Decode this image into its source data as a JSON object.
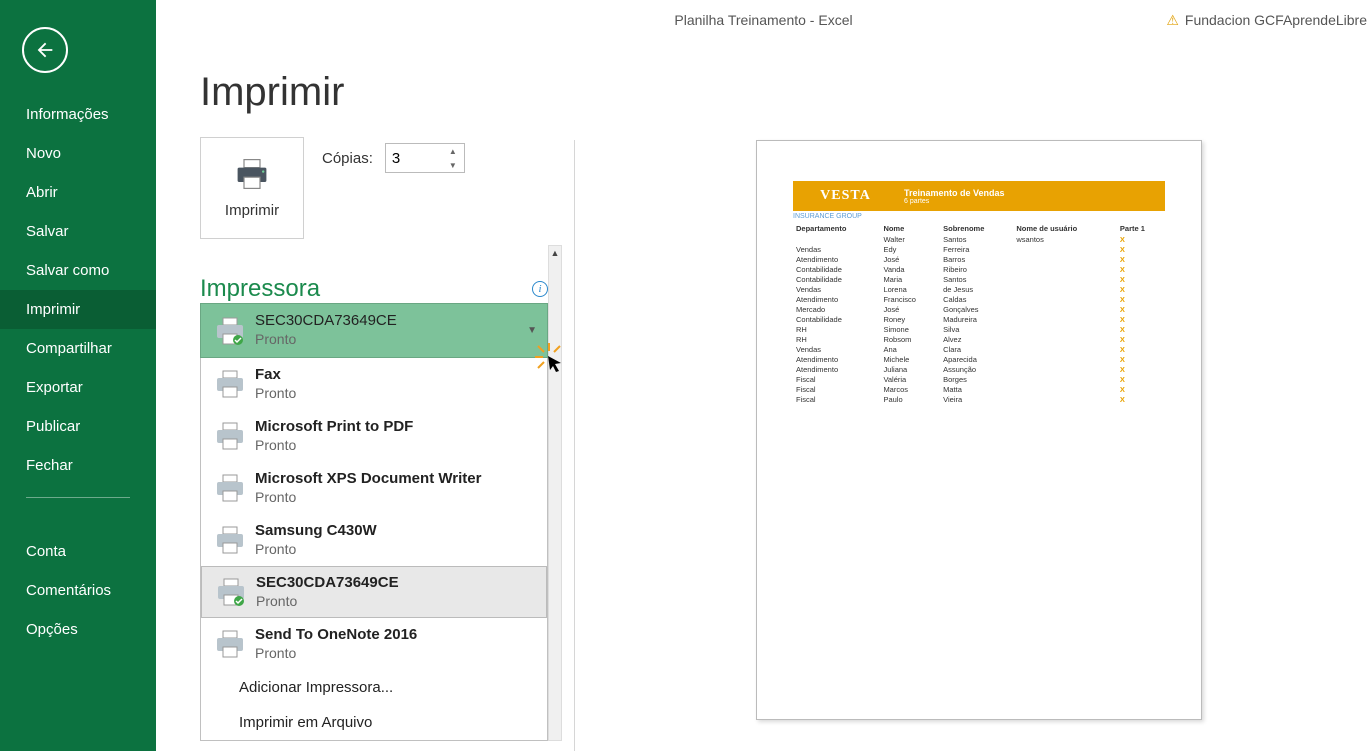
{
  "titlebar": {
    "doc": "Planilha Treinamento",
    "sep": "  -  ",
    "app": "Excel",
    "user": "Fundacion GCFAprendeLibre"
  },
  "sidebar": {
    "items": [
      "Informações",
      "Novo",
      "Abrir",
      "Salvar",
      "Salvar como",
      "Imprimir",
      "Compartilhar",
      "Exportar",
      "Publicar",
      "Fechar"
    ],
    "items2": [
      "Conta",
      "Comentários",
      "Opções"
    ],
    "active_index": 5
  },
  "page": {
    "title": "Imprimir"
  },
  "print_button": {
    "label": "Imprimir"
  },
  "copies": {
    "label": "Cópias:",
    "value": "3"
  },
  "printer_section": {
    "title": "Impressora"
  },
  "selected_printer": {
    "name": "SEC30CDA73649CE",
    "status": "Pronto"
  },
  "printer_list": [
    {
      "name": "Fax",
      "status": "Pronto",
      "check": false
    },
    {
      "name": "Microsoft Print to PDF",
      "status": "Pronto",
      "check": false
    },
    {
      "name": "Microsoft XPS Document Writer",
      "status": "Pronto",
      "check": false
    },
    {
      "name": "Samsung C430W",
      "status": "Pronto",
      "check": false
    },
    {
      "name": "SEC30CDA73649CE",
      "status": "Pronto",
      "check": true,
      "hl": true
    },
    {
      "name": "Send To OneNote 2016",
      "status": "Pronto",
      "check": false
    }
  ],
  "printer_menu": {
    "add": "Adicionar Impressora...",
    "file": "Imprimir em Arquivo"
  },
  "preview": {
    "brand": "VESTA",
    "title": "Treinamento de Vendas",
    "subtitle": "6 partes",
    "group": "INSURANCE GROUP",
    "headers": [
      "Departamento",
      "Nome",
      "Sobrenome",
      "Nome de usuário",
      "Parte 1"
    ],
    "rows": [
      [
        "",
        "Walter",
        "Santos",
        "wsantos",
        "X"
      ],
      [
        "Vendas",
        "Edy",
        "Ferreira",
        "",
        "X"
      ],
      [
        "Atendimento",
        "José",
        "Barros",
        "",
        "X"
      ],
      [
        "Contabilidade",
        "Vanda",
        "Ribeiro",
        "",
        "X"
      ],
      [
        "Contabilidade",
        "Maria",
        "Santos",
        "",
        "X"
      ],
      [
        "Vendas",
        "Lorena",
        "de Jesus",
        "",
        "X"
      ],
      [
        "Atendimento",
        "Francisco",
        "Caldas",
        "",
        "X"
      ],
      [
        "Mercado",
        "José",
        "Gonçalves",
        "",
        "X"
      ],
      [
        "Contabilidade",
        "Roney",
        "Madureira",
        "",
        "X"
      ],
      [
        "RH",
        "Simone",
        "Silva",
        "",
        "X"
      ],
      [
        "RH",
        "Robsom",
        "Alvez",
        "",
        "X"
      ],
      [
        "Vendas",
        "Ana",
        "Clara",
        "",
        "X"
      ],
      [
        "Atendimento",
        "Michele",
        "Aparecida",
        "",
        "X"
      ],
      [
        "Atendimento",
        "Juliana",
        "Assunção",
        "",
        "X"
      ],
      [
        "Fiscal",
        "Valéria",
        "Borges",
        "",
        "X"
      ],
      [
        "Fiscal",
        "Marcos",
        "Matta",
        "",
        "X"
      ],
      [
        "Fiscal",
        "Paulo",
        "Vieira",
        "",
        "X"
      ]
    ]
  }
}
